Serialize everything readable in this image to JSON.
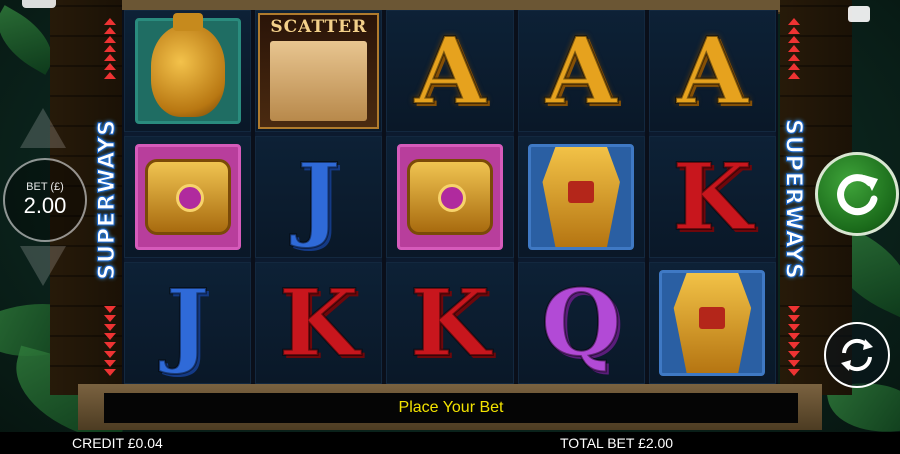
{
  "bet": {
    "label": "BET (£)",
    "value": "2.00"
  },
  "branding": {
    "feature_label": "SUPERWAYS"
  },
  "scatter": {
    "label": "SCATTER"
  },
  "reels": [
    [
      {
        "kind": "vase",
        "icon": "golden-vase-icon"
      },
      {
        "kind": "cuff",
        "icon": "golden-cuff-icon"
      },
      {
        "kind": "letter",
        "text": "J",
        "color": "blue"
      }
    ],
    [
      {
        "kind": "scatter",
        "icon": "scatter-map-icon"
      },
      {
        "kind": "letter",
        "text": "J",
        "color": "blue"
      },
      {
        "kind": "letter",
        "text": "K",
        "color": "red"
      }
    ],
    [
      {
        "kind": "letter",
        "text": "A",
        "color": "gold"
      },
      {
        "kind": "cuff",
        "icon": "golden-cuff-icon"
      },
      {
        "kind": "letter",
        "text": "K",
        "color": "red"
      }
    ],
    [
      {
        "kind": "letter",
        "text": "A",
        "color": "gold"
      },
      {
        "kind": "idol",
        "icon": "golden-idol-monkey-icon"
      },
      {
        "kind": "letter",
        "text": "Q",
        "color": "purple"
      }
    ],
    [
      {
        "kind": "letter",
        "text": "A",
        "color": "gold"
      },
      {
        "kind": "letter",
        "text": "K",
        "color": "red"
      },
      {
        "kind": "idol",
        "icon": "golden-idol-monkey-icon"
      }
    ]
  ],
  "message": "Place Your Bet",
  "footer": {
    "credit_label": "CREDIT",
    "credit_value": "£0.04",
    "total_bet_label": "TOTAL BET",
    "total_bet_value": "£2.00"
  },
  "colors": {
    "accent_green": "#2f8f2a",
    "message_text": "#f3e300"
  }
}
